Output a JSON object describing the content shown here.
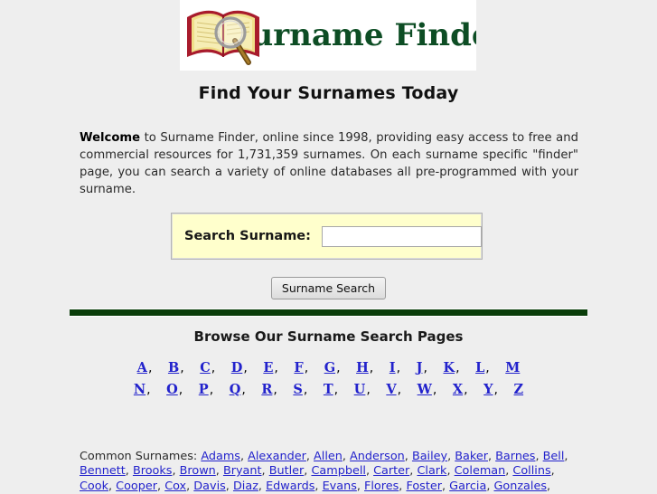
{
  "colors": {
    "page_background": "#eeeeee",
    "banner_background": "#ffffff",
    "wordmark_green": "#0d4d24",
    "rule_green": "#0a3d0a",
    "link_blue": "#2222cc",
    "search_panel_yellow": "#ffffcc"
  },
  "logo": {
    "wordmark": "Surname Finder",
    "art_icon": "open-book-with-magnifier-icon"
  },
  "page_title": "Find Your Surnames Today",
  "intro": {
    "lead": "Welcome",
    "body": " to Surname Finder, online since 1998, providing easy access to free and commercial resources for 1,731,359 surnames. On each surname specific \"finder\" page, you can search a variety of online databases all pre-programmed with your surname.",
    "surname_count": "1,731,359",
    "since_year": "1998"
  },
  "search": {
    "label": "Search Surname:",
    "value": "",
    "placeholder": "",
    "submit_label": "Surname Search"
  },
  "browse": {
    "title": "Browse Our Surname Search Pages",
    "separator": ",",
    "row1": [
      "A",
      "B",
      "C",
      "D",
      "E",
      "F",
      "G",
      "H",
      "I",
      "J",
      "K",
      "L",
      "M"
    ],
    "row2": [
      "N",
      "O",
      "P",
      "Q",
      "R",
      "S",
      "T",
      "U",
      "V",
      "W",
      "X",
      "Y",
      "Z"
    ]
  },
  "common_surnames": {
    "label": "Common Surnames:",
    "names": [
      "Adams",
      "Alexander",
      "Allen",
      "Anderson",
      "Bailey",
      "Baker",
      "Barnes",
      "Bell",
      "Bennett",
      "Brooks",
      "Brown",
      "Bryant",
      "Butler",
      "Campbell",
      "Carter",
      "Clark",
      "Coleman",
      "Collins",
      "Cook",
      "Cooper",
      "Cox",
      "Davis",
      "Diaz",
      "Edwards",
      "Evans",
      "Flores",
      "Foster",
      "Garcia",
      "Gonzales"
    ]
  }
}
